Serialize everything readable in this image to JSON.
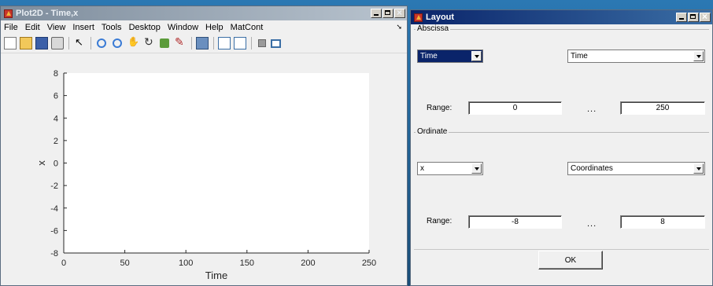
{
  "plot_window": {
    "title": "Plot2D - Time,x",
    "menu": [
      "File",
      "Edit",
      "View",
      "Insert",
      "Tools",
      "Desktop",
      "Window",
      "Help",
      "MatCont"
    ],
    "toolbar_icons": [
      "new-figure-icon",
      "open-file-icon",
      "save-icon",
      "print-icon",
      "edit-plot-icon",
      "zoom-in-icon",
      "zoom-out-icon",
      "pan-icon",
      "rotate-3d-icon",
      "data-cursor-icon",
      "brush-icon",
      "link-plot-icon",
      "colorbar-icon",
      "legend-icon",
      "hide-plot-tools-icon",
      "show-plot-tools-icon"
    ]
  },
  "chart_data": {
    "type": "line",
    "title": "",
    "xlabel": "Time",
    "ylabel": "x",
    "xlim": [
      0,
      250
    ],
    "ylim": [
      -8,
      8
    ],
    "xticks": [
      0,
      50,
      100,
      150,
      200,
      250
    ],
    "yticks": [
      -8,
      -6,
      -4,
      -2,
      0,
      2,
      4,
      6,
      8
    ],
    "series": [],
    "grid": false
  },
  "layout_dialog": {
    "title": "Layout",
    "abscissa": {
      "group_label": "Abscissa",
      "left_select": "Time",
      "right_select": "Time",
      "range_label": "Range:",
      "range_min": "0",
      "range_sep": "...",
      "range_max": "250"
    },
    "ordinate": {
      "group_label": "Ordinate",
      "left_select": "x",
      "right_select": "Coordinates",
      "range_label": "Range:",
      "range_min": "-8",
      "range_sep": "...",
      "range_max": "8"
    },
    "ok_label": "OK"
  }
}
